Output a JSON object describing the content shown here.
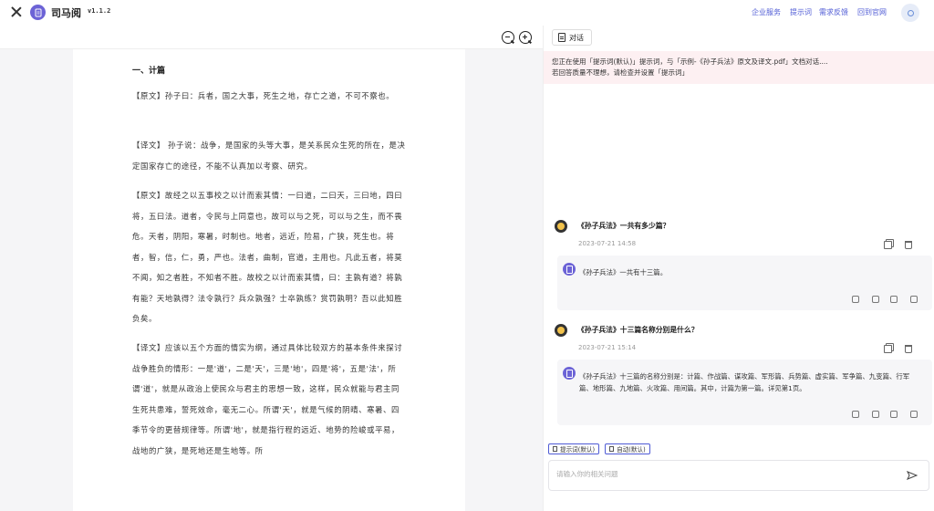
{
  "header": {
    "app_title": "司马阅",
    "version": "v1.1.2",
    "nav": [
      "企业服务",
      "提示词",
      "需求反馈",
      "回到官网"
    ]
  },
  "document": {
    "section_title": "一、计篇",
    "paragraphs": [
      "【原文】孙子曰：兵者，国之大事，死生之地，存亡之道，不可不察也。",
      "【译文】 孙子说：战争，是国家的头等大事，是关系民众生死的所在，是决定国家存亡的途径，不能不认真加以考察、研究。",
      "【原文】故经之以五事校之以计而索其情：一曰道，二曰天，三曰地，四曰将，五曰法。道者，令民与上同意也，故可以与之死，可以与之生，而不畏危。天者，阴阳，寒暑，时制也。地者，远近，险易，广狭，死生也。将者，智，信，仁，勇，严也。法者，曲制，官道，主用也。凡此五者，将莫不闻，知之者胜，不知者不胜。故校之以计而索其情，曰：主孰有道？将孰有能？天地孰得？法令孰行？兵众孰强？士卒孰练？赏罚孰明？吾以此知胜负矣。",
      "【译文】应该以五个方面的情实为纲，通过具体比较双方的基本条件来探讨战争胜负的情形：一是'道'，二是'天'，三是'地'，四是'将'，五是'法'，所谓'道'，就是从政治上使民众与君主的思想一致，这样，民众就能与君主同生死共患难，誓死效命，毫无二心。所谓'天'，就是气候的阴晴、寒暑、四季节令的更替规律等。所谓'地'，就是指行程的远近、地势的险峻或平易，战地的广狭，是死地还是生地等。所"
    ]
  },
  "chat": {
    "tab_label": "对话",
    "notice_line1": "您正在使用「提示词(默认)」提示词，与「示例-《孙子兵法》原文及译文.pdf」文档对话....",
    "notice_line2": "若回答质量不理想，请检查并设置「提示词」",
    "messages": [
      {
        "question": "《孙子兵法》一共有多少篇？",
        "time": "2023-07-21 14:58",
        "answer": "《孙子兵法》一共有十三篇。"
      },
      {
        "question": "《孙子兵法》十三篇名称分别是什么？",
        "time": "2023-07-21 15:14",
        "answer": "《孙子兵法》十三篇的名称分别是：计篇、作战篇、谋攻篇、军形篇、兵势篇、虚实篇、军争篇、九变篇、行军篇、地形篇、九地篇、火攻篇、用间篇。其中，计篇为第一篇。详见第1页。"
      }
    ],
    "chip_prompt": "提示词(默认)",
    "chip_auto": "自动(默认)",
    "input_placeholder": "请输入你的相关问题"
  }
}
